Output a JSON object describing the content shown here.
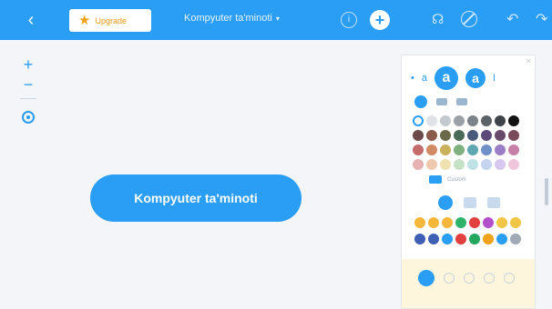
{
  "topbar": {
    "back_icon": "chevron-left-icon",
    "upgrade_label": "Upgrade",
    "upgrade_icon": "star-icon",
    "title": "Kompyuter ta'minoti",
    "title_caret": "▾",
    "info_label": "i",
    "add_label": "+",
    "share_icon": "share-icon",
    "undo_icon": "undo-icon",
    "redo_icon": "redo-icon",
    "accent": "#2a9df4"
  },
  "zoom": {
    "in_label": "+",
    "out_label": "−"
  },
  "canvas": {
    "node_text": "Kompyuter ta'minoti",
    "node_color": "#2a9df4"
  },
  "style_panel": {
    "font_row": [
      "•",
      "a",
      "a",
      "a",
      "I"
    ],
    "swatch_colors": [
      "#ffffff",
      "#dfe3e8",
      "#c4c9cf",
      "#9aa1a8",
      "#7b828a",
      "#5b6168",
      "#3f444a",
      "#111111",
      "#6d4a4a",
      "#8a5b4a",
      "#6a6a4a",
      "#4a6a5a",
      "#4a5a7a",
      "#5a4a7a",
      "#6a4a6a",
      "#7a4a5a",
      "#c46c6c",
      "#d28a63",
      "#c9b15b",
      "#7fb07f",
      "#5fa7b0",
      "#6f8fc9",
      "#9a7fc6",
      "#c67fa7",
      "#e7b2b2",
      "#efc8b0",
      "#efe1b0",
      "#c6e2c6",
      "#bfe0e5",
      "#c6d3ef",
      "#d6c8ef",
      "#efc6dc"
    ],
    "custom_label": "Custom",
    "emoji_colors": [
      "#f4b73b",
      "#f4b73b",
      "#f4b73b",
      "#2fb36b",
      "#e2403f",
      "#b44fc9",
      "#f1c545",
      "#f1c545",
      "#3e5fb3",
      "#3e5fb3",
      "#2a9df4",
      "#e2403f",
      "#23a65e",
      "#f1a21b",
      "#2a9df4",
      "#a0aab6"
    ]
  }
}
